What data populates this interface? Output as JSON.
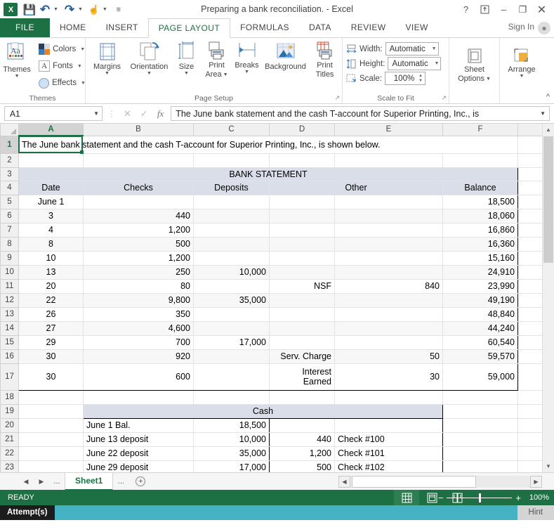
{
  "window": {
    "title": "Preparing a bank reconciliation. - Excel",
    "help_icon": "?",
    "ribbon_display_icon": "ribbon-display-options-icon",
    "minimize_icon": "‒",
    "restore_icon": "❐",
    "close_icon": "✕",
    "signin": "Sign In"
  },
  "qat": {
    "logo": "X",
    "save_label": "save-icon",
    "undo_label": "undo-icon",
    "redo_label": "redo-icon",
    "touch_label": "touch-mode-icon",
    "more_label": "customize-qat-icon"
  },
  "tabs": [
    {
      "label": "FILE",
      "active": false,
      "file": true
    },
    {
      "label": "HOME",
      "active": false
    },
    {
      "label": "INSERT",
      "active": false
    },
    {
      "label": "PAGE LAYOUT",
      "active": true
    },
    {
      "label": "FORMULAS",
      "active": false
    },
    {
      "label": "DATA",
      "active": false
    },
    {
      "label": "REVIEW",
      "active": false
    },
    {
      "label": "VIEW",
      "active": false
    }
  ],
  "ribbon": {
    "groups": {
      "themes": {
        "label": "Themes",
        "themes_btn": "Themes",
        "colors_btn": "Colors",
        "fonts_btn": "Fonts",
        "effects_btn": "Effects"
      },
      "page_setup": {
        "label": "Page Setup",
        "margins": "Margins",
        "orientation": "Orientation",
        "size": "Size",
        "print_area_line1": "Print",
        "print_area_line2": "Area",
        "breaks": "Breaks",
        "background": "Background",
        "print_titles_line1": "Print",
        "print_titles_line2": "Titles"
      },
      "scale_to_fit": {
        "label": "Scale to Fit",
        "width_label": "Width:",
        "width_value": "Automatic",
        "height_label": "Height:",
        "height_value": "Automatic",
        "scale_label": "Scale:",
        "scale_value": "100%"
      },
      "sheet_options": {
        "label": "",
        "button_line1": "Sheet",
        "button_line2": "Options"
      },
      "arrange": {
        "label": "",
        "button": "Arrange"
      }
    }
  },
  "formula_bar": {
    "name_box": "A1",
    "cancel_icon": "✕",
    "enter_icon": "✓",
    "function_icon": "fx",
    "content": "The June bank statement and the cash T-account for Superior Printing, Inc., is"
  },
  "grid": {
    "columns": [
      "A",
      "B",
      "C",
      "D",
      "E",
      "F"
    ],
    "selected_column": "A",
    "selected_row": "1",
    "rows": [
      {
        "n": "1",
        "cells": [
          {
            "v": "The June bank statement and the cash T-account for Superior Printing, Inc., is shown below.",
            "span": 6,
            "align": "left"
          }
        ]
      },
      {
        "n": "2",
        "cells": []
      },
      {
        "n": "3",
        "cells": [
          {
            "v": "BANK STATEMENT",
            "span": 6,
            "align": "center",
            "fill": true
          }
        ]
      },
      {
        "n": "4",
        "cells": [
          {
            "v": "Date",
            "align": "center",
            "fill": true
          },
          {
            "v": "Checks",
            "align": "center",
            "fill": true
          },
          {
            "v": "Deposits",
            "align": "center",
            "fill": true
          },
          {
            "v": "Other",
            "align": "center",
            "fill": true,
            "span": 2
          },
          {
            "v": "Balance",
            "align": "center",
            "fill": true
          }
        ]
      },
      {
        "n": "5",
        "cells": [
          {
            "v": "June 1",
            "align": "center"
          },
          {
            "v": ""
          },
          {
            "v": ""
          },
          {
            "v": ""
          },
          {
            "v": ""
          },
          {
            "v": "18,500",
            "align": "right"
          }
        ]
      },
      {
        "n": "6",
        "alt": true,
        "cells": [
          {
            "v": "3",
            "align": "center"
          },
          {
            "v": "440",
            "align": "right"
          },
          {
            "v": ""
          },
          {
            "v": ""
          },
          {
            "v": ""
          },
          {
            "v": "18,060",
            "align": "right"
          }
        ]
      },
      {
        "n": "7",
        "cells": [
          {
            "v": "4",
            "align": "center"
          },
          {
            "v": "1,200",
            "align": "right"
          },
          {
            "v": ""
          },
          {
            "v": ""
          },
          {
            "v": ""
          },
          {
            "v": "16,860",
            "align": "right"
          }
        ]
      },
      {
        "n": "8",
        "alt": true,
        "cells": [
          {
            "v": "8",
            "align": "center"
          },
          {
            "v": "500",
            "align": "right"
          },
          {
            "v": ""
          },
          {
            "v": ""
          },
          {
            "v": ""
          },
          {
            "v": "16,360",
            "align": "right"
          }
        ]
      },
      {
        "n": "9",
        "cells": [
          {
            "v": "10",
            "align": "center"
          },
          {
            "v": "1,200",
            "align": "right"
          },
          {
            "v": ""
          },
          {
            "v": ""
          },
          {
            "v": ""
          },
          {
            "v": "15,160",
            "align": "right"
          }
        ]
      },
      {
        "n": "10",
        "alt": true,
        "cells": [
          {
            "v": "13",
            "align": "center"
          },
          {
            "v": "250",
            "align": "right"
          },
          {
            "v": "10,000",
            "align": "right"
          },
          {
            "v": ""
          },
          {
            "v": ""
          },
          {
            "v": "24,910",
            "align": "right"
          }
        ]
      },
      {
        "n": "11",
        "cells": [
          {
            "v": "20",
            "align": "center"
          },
          {
            "v": "80",
            "align": "right"
          },
          {
            "v": ""
          },
          {
            "v": "NSF",
            "align": "right"
          },
          {
            "v": "840",
            "align": "right"
          },
          {
            "v": "23,990",
            "align": "right"
          }
        ]
      },
      {
        "n": "12",
        "alt": true,
        "cells": [
          {
            "v": "22",
            "align": "center"
          },
          {
            "v": "9,800",
            "align": "right"
          },
          {
            "v": "35,000",
            "align": "right"
          },
          {
            "v": ""
          },
          {
            "v": ""
          },
          {
            "v": "49,190",
            "align": "right"
          }
        ]
      },
      {
        "n": "13",
        "cells": [
          {
            "v": "26",
            "align": "center"
          },
          {
            "v": "350",
            "align": "right"
          },
          {
            "v": ""
          },
          {
            "v": ""
          },
          {
            "v": ""
          },
          {
            "v": "48,840",
            "align": "right"
          }
        ]
      },
      {
        "n": "14",
        "alt": true,
        "cells": [
          {
            "v": "27",
            "align": "center"
          },
          {
            "v": "4,600",
            "align": "right"
          },
          {
            "v": ""
          },
          {
            "v": ""
          },
          {
            "v": ""
          },
          {
            "v": "44,240",
            "align": "right"
          }
        ]
      },
      {
        "n": "15",
        "cells": [
          {
            "v": "29",
            "align": "center"
          },
          {
            "v": "700",
            "align": "right"
          },
          {
            "v": "17,000",
            "align": "right"
          },
          {
            "v": ""
          },
          {
            "v": ""
          },
          {
            "v": "60,540",
            "align": "right"
          }
        ]
      },
      {
        "n": "16",
        "alt": true,
        "cells": [
          {
            "v": "30",
            "align": "center"
          },
          {
            "v": "920",
            "align": "right"
          },
          {
            "v": ""
          },
          {
            "v": "Serv. Charge",
            "align": "right"
          },
          {
            "v": "50",
            "align": "right"
          },
          {
            "v": "59,570",
            "align": "right"
          }
        ]
      },
      {
        "n": "17",
        "tall": true,
        "cells": [
          {
            "v": "30",
            "align": "center"
          },
          {
            "v": "600",
            "align": "right"
          },
          {
            "v": ""
          },
          {
            "v": "Interest Earned",
            "align": "right",
            "wrap": true
          },
          {
            "v": "30",
            "align": "right"
          },
          {
            "v": "59,000",
            "align": "right"
          }
        ]
      },
      {
        "n": "18",
        "cells": []
      },
      {
        "n": "19",
        "cells": [
          {
            "v": "Cash",
            "align": "center",
            "fill": true,
            "cash_header": true
          }
        ]
      },
      {
        "n": "20",
        "cells": [
          {
            "v": ""
          },
          {
            "v": "June 1 Bal.",
            "align": "left"
          },
          {
            "v": "18,500",
            "align": "right"
          },
          {
            "v": "",
            "align": "right"
          },
          {
            "v": ""
          }
        ]
      },
      {
        "n": "21",
        "cells": [
          {
            "v": ""
          },
          {
            "v": "June 13 deposit",
            "align": "left"
          },
          {
            "v": "10,000",
            "align": "right"
          },
          {
            "v": "440",
            "align": "right"
          },
          {
            "v": "Check #100",
            "align": "left"
          }
        ]
      },
      {
        "n": "22",
        "cells": [
          {
            "v": ""
          },
          {
            "v": "June 22 deposit",
            "align": "left"
          },
          {
            "v": "35,000",
            "align": "right"
          },
          {
            "v": "1,200",
            "align": "right"
          },
          {
            "v": "Check #101",
            "align": "left"
          }
        ]
      },
      {
        "n": "23",
        "cells": [
          {
            "v": ""
          },
          {
            "v": "June 29 deposit",
            "align": "left"
          },
          {
            "v": "17,000",
            "align": "right"
          },
          {
            "v": "500",
            "align": "right"
          },
          {
            "v": "Check #102",
            "align": "left"
          }
        ]
      }
    ]
  },
  "sheet_tabs": {
    "prev_icon": "◀",
    "next_icon": "▶",
    "left_dots": "...",
    "right_dots": "...",
    "active_sheet": "Sheet1",
    "add_sheet": "+"
  },
  "status_bar": {
    "mode": "READY",
    "view_normal": "normal-view-icon",
    "view_page_layout": "page-layout-view-icon",
    "view_page_break": "page-break-view-icon",
    "zoom_out": "−",
    "zoom_in": "+",
    "zoom_level": "100%"
  },
  "bottom_bar": {
    "attempts_label": "Attempt(s)",
    "hint_label": "Hint"
  },
  "colors": {
    "excel_green": "#1d7044",
    "header_fill": "#d9dee8",
    "alt_row": "#f7f7f7",
    "teal_bar": "#45b2c4"
  }
}
